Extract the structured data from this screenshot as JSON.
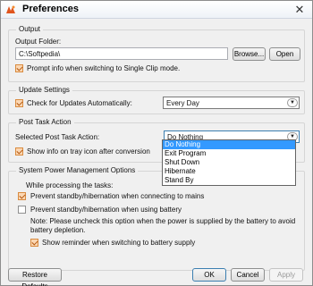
{
  "window": {
    "title": "Preferences",
    "close_glyph": "✕",
    "app_icon": "app-logo-icon"
  },
  "output": {
    "legend": "Output",
    "folder_label": "Output Folder:",
    "folder_value": "C:\\Softpedia\\",
    "browse_label": "Browse...",
    "open_label": "Open",
    "prompt_label": "Prompt info when switching to Single Clip mode.",
    "prompt_checked": true
  },
  "update": {
    "legend": "Update Settings",
    "check_label": "Check for Updates Automatically:",
    "check_checked": true,
    "frequency_value": "Every Day"
  },
  "post_task": {
    "legend": "Post Task Action",
    "select_label": "Selected Post Task Action:",
    "select_value": "Do Nothing",
    "tray_label": "Show info on tray icon after conversion",
    "tray_checked": true,
    "options": [
      "Do Nothing",
      "Exit Program",
      "Shut Down",
      "Hibernate",
      "Stand By"
    ],
    "selected_index": 0
  },
  "power": {
    "legend": "System Power Management Options",
    "while_label": "While processing the tasks:",
    "prevent_mains_label": "Prevent standby/hibernation when connecting to mains",
    "prevent_mains_checked": true,
    "prevent_battery_label": "Prevent standby/hibernation when using battery",
    "prevent_battery_checked": false,
    "note_line1": "Note: Please uncheck this option when the power is supplied by the battery to avoid",
    "note_line2": "battery depletion.",
    "reminder_label": "Show reminder when switching to battery supply",
    "reminder_checked": true
  },
  "footer": {
    "restore_label": "Restore Defaults",
    "ok_label": "OK",
    "cancel_label": "Cancel",
    "apply_label": "Apply"
  },
  "colors": {
    "accent": "#3399ff",
    "check_fill": "#fbd7b3",
    "check_mark": "#b2560d"
  }
}
